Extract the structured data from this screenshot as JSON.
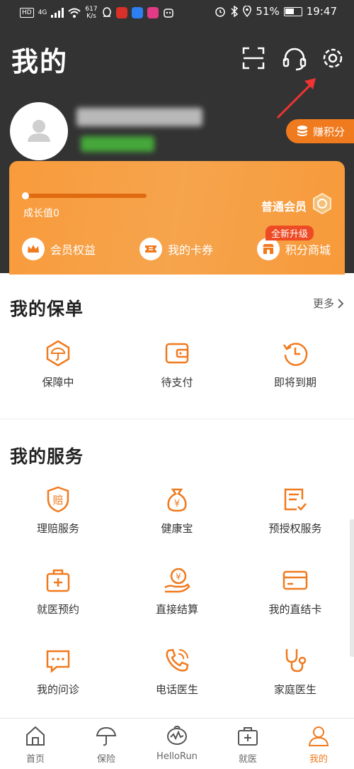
{
  "status_bar": {
    "network_badge": "HD",
    "network_type": "4G",
    "speed_value": "617",
    "speed_unit": "K/s",
    "battery": "51%",
    "time": "19:47"
  },
  "header": {
    "title": "我的",
    "scan_icon": "scan-icon",
    "service_icon": "headset-icon",
    "settings_icon": "gear-icon"
  },
  "profile": {
    "earn_points_label": "赚积分"
  },
  "member_card": {
    "growth_label": "成长值0",
    "growth_progress": 0,
    "level": "普通会员",
    "upgrade_badge": "全新升级",
    "perks": [
      {
        "label": "会员权益",
        "icon": "crown-icon"
      },
      {
        "label": "我的卡券",
        "icon": "ticket-icon"
      },
      {
        "label": "积分商城",
        "icon": "shop-icon"
      }
    ]
  },
  "policy": {
    "title": "我的保单",
    "more_label": "更多",
    "items": [
      {
        "label": "保障中",
        "icon": "umbrella-shield-icon"
      },
      {
        "label": "待支付",
        "icon": "wallet-icon"
      },
      {
        "label": "即将到期",
        "icon": "clock-back-icon"
      }
    ]
  },
  "services": {
    "title": "我的服务",
    "items": [
      {
        "label": "理赔服务",
        "icon": "claim-shield-icon",
        "glyph": "赔"
      },
      {
        "label": "健康宝",
        "icon": "money-bag-icon",
        "glyph": "¥"
      },
      {
        "label": "预授权服务",
        "icon": "form-check-icon"
      },
      {
        "label": "就医预约",
        "icon": "medical-kit-icon"
      },
      {
        "label": "直接结算",
        "icon": "coin-hand-icon",
        "glyph": "¥"
      },
      {
        "label": "我的直结卡",
        "icon": "card-icon"
      },
      {
        "label": "我的问诊",
        "icon": "chat-icon"
      },
      {
        "label": "电话医生",
        "icon": "phone-icon"
      },
      {
        "label": "家庭医生",
        "icon": "stethoscope-icon"
      }
    ]
  },
  "tabbar": {
    "tabs": [
      {
        "label": "首页",
        "icon": "home-icon"
      },
      {
        "label": "保险",
        "icon": "umbrella-icon"
      },
      {
        "label": "HelloRun",
        "icon": "hellorun-icon"
      },
      {
        "label": "就医",
        "icon": "medical-case-icon"
      },
      {
        "label": "我的",
        "icon": "person-icon",
        "active": true
      }
    ]
  },
  "colors": {
    "accent": "#f07a1e",
    "header_bg": "#333333",
    "card_orange": "#f7a045",
    "badge_red": "#ee4a24"
  }
}
